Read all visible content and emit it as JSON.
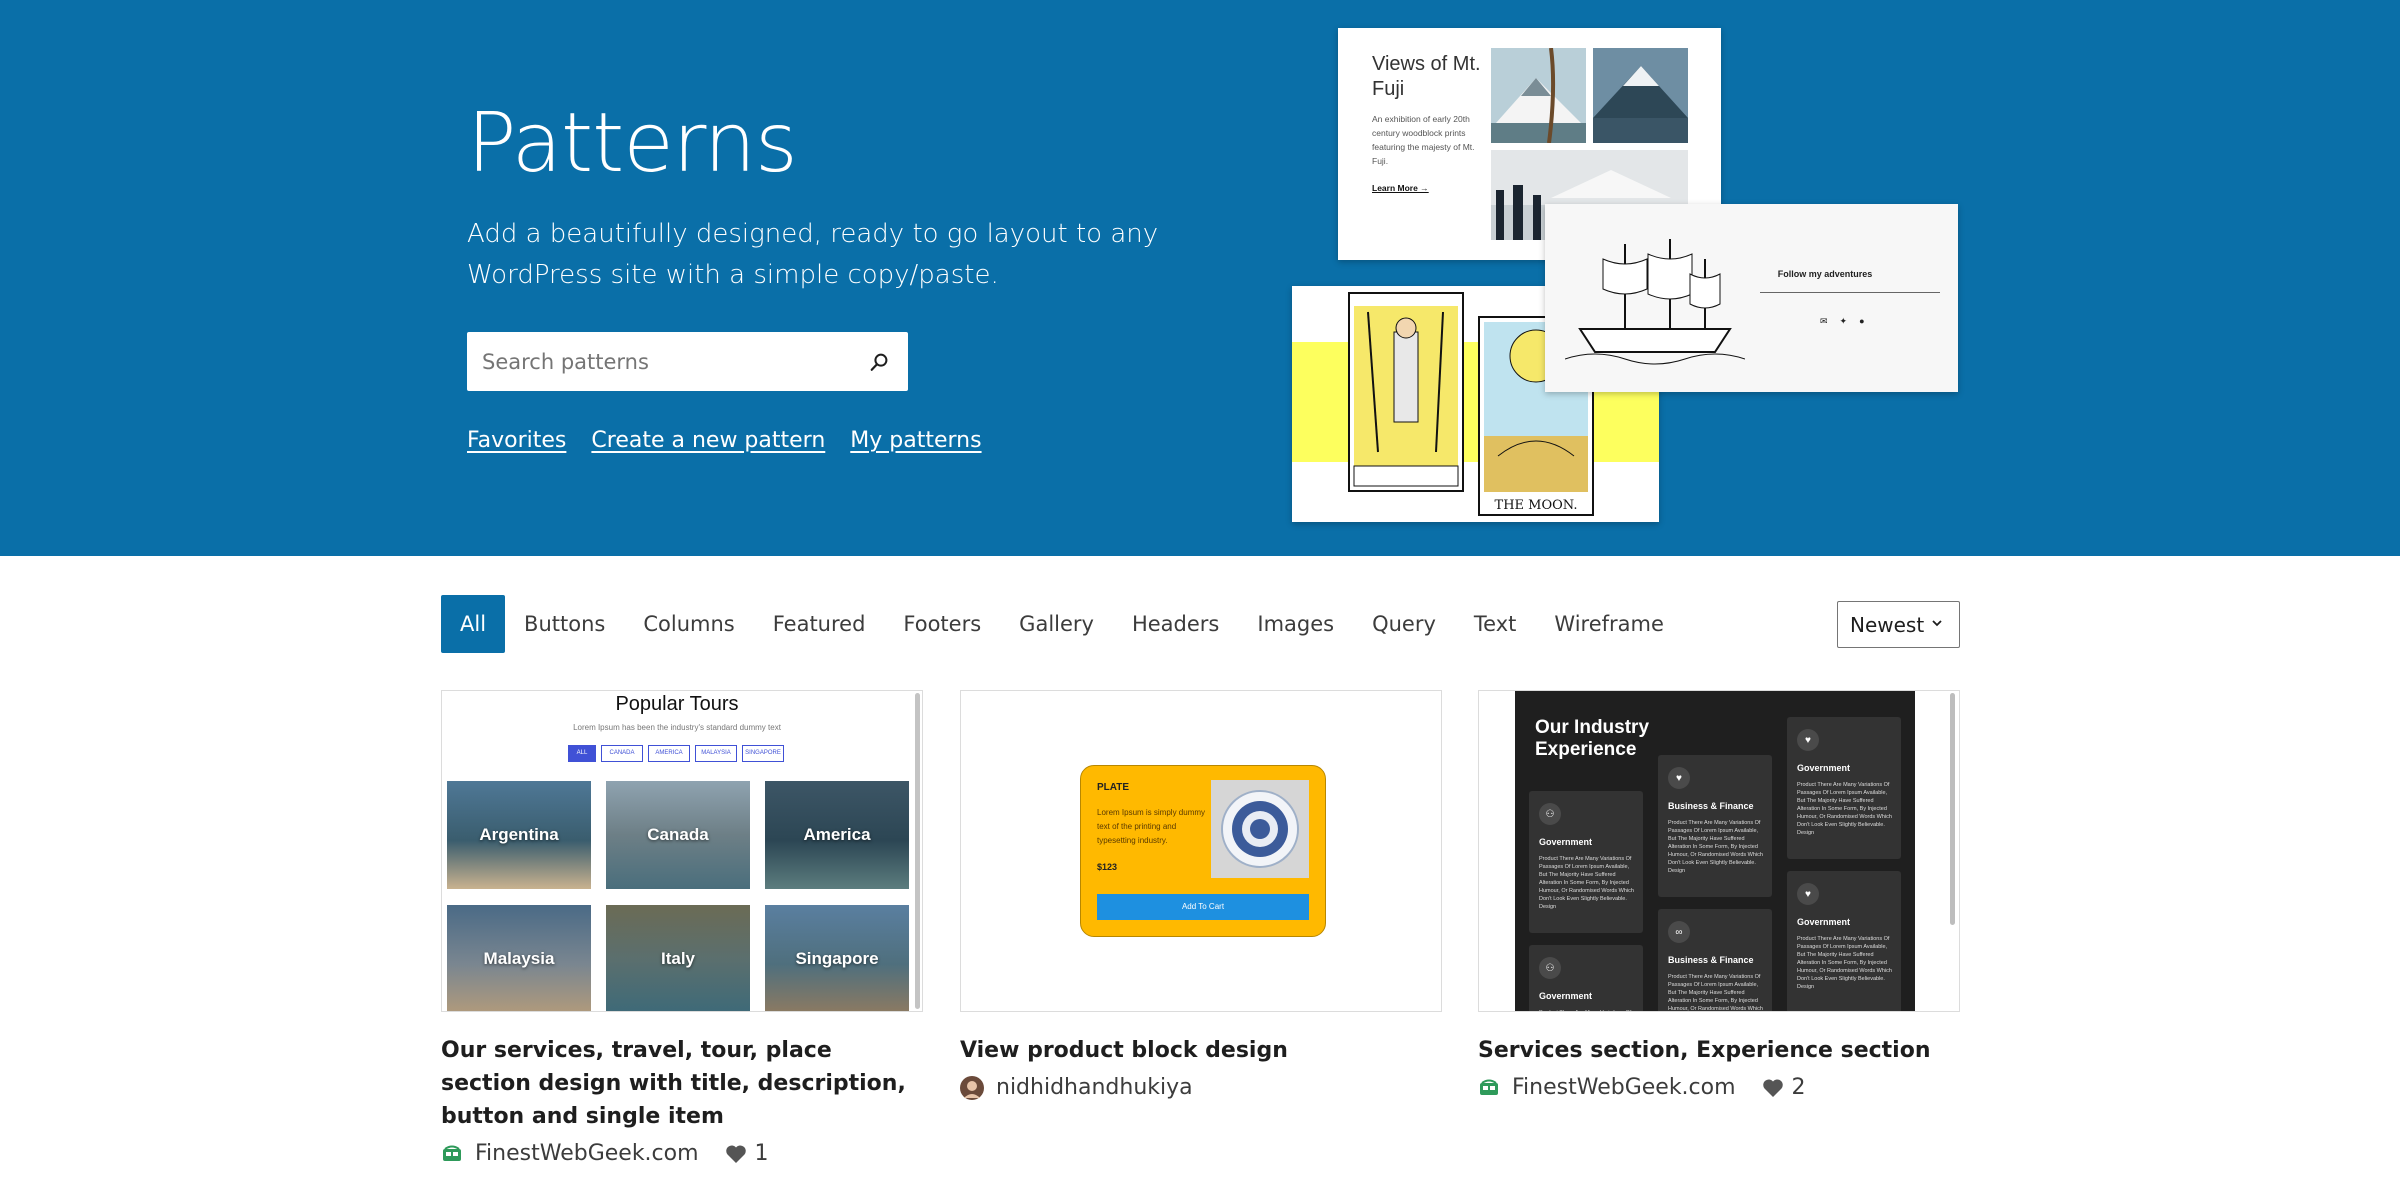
{
  "hero": {
    "title": "Patterns",
    "description": "Add a beautifully designed, ready to go layout to any WordPress site with a simple copy/paste.",
    "search_placeholder": "Search patterns",
    "links": [
      "Favorites",
      "Create a new pattern",
      "My patterns"
    ]
  },
  "collage": {
    "fuji_title": "Views of Mt. Fuji",
    "fuji_desc": "An exhibition of early 20th century woodblock prints featuring the majesty of Mt. Fuji.",
    "fuji_link": "Learn More →",
    "follow_text": "Follow my adventures",
    "tarot_moon": "THE MOON."
  },
  "filters": {
    "items": [
      "All",
      "Buttons",
      "Columns",
      "Featured",
      "Footers",
      "Gallery",
      "Headers",
      "Images",
      "Query",
      "Text",
      "Wireframe"
    ],
    "active": "All",
    "sort_value": "Newest"
  },
  "patterns": [
    {
      "title": "Our services, travel, tour, place section design with title, description, button and single item",
      "author": "FinestWebGeek.com",
      "likes": "1",
      "preview": {
        "heading": "Popular Tours",
        "subheading": "Lorem Ipsum has been the industry's standard dummy text",
        "tabs": [
          "ALL",
          "CANADA",
          "AMERICA",
          "MALAYSIA",
          "SINGAPORE"
        ],
        "tiles": [
          "Argentina",
          "Canada",
          "America",
          "Malaysia",
          "Italy",
          "Singapore"
        ]
      }
    },
    {
      "title": "View product block design",
      "author": "nidhidhandhukiya",
      "likes": "",
      "preview": {
        "label": "PLATE",
        "desc": "Lorem Ipsum is simply dummy text of the printing and typesetting industry.",
        "price": "$123",
        "button": "Add To Cart"
      }
    },
    {
      "title": "Services section, Experience section",
      "author": "FinestWebGeek.com",
      "likes": "2",
      "preview": {
        "heading": "Our Industry Experience",
        "card_body": "Product There Are Many Variations Of Passages Of Lorem Ipsum Available, But The Majority Have Suffered Alteration In Some Form, By Injected Humour, Or Randomised Words Which Don't Look Even Slightly Believable. Design",
        "cards": [
          "Government",
          "Business & Finance",
          "Government",
          "Government",
          "Business & Finance",
          "Government"
        ]
      }
    }
  ],
  "colors": {
    "brand_blue": "#0a6fa8",
    "plate_yellow": "#ffb900",
    "tarot_yellow": "#fdff5e"
  }
}
